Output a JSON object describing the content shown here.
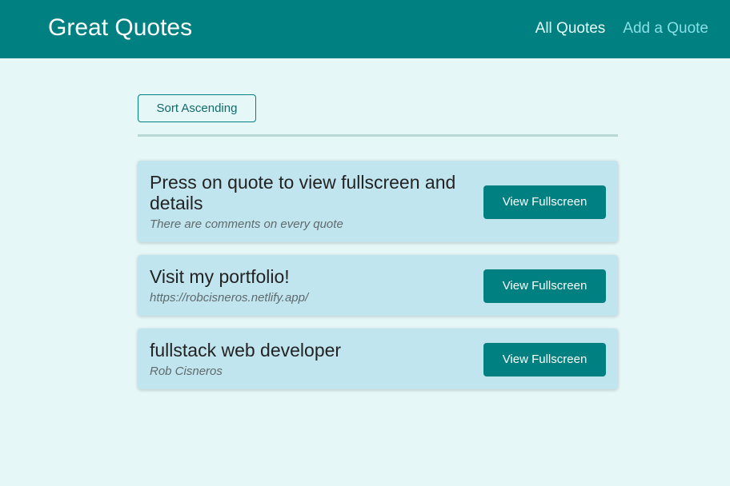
{
  "header": {
    "logo": "Great Quotes",
    "nav": [
      {
        "label": "All Quotes",
        "active": true
      },
      {
        "label": "Add a Quote",
        "active": false
      }
    ]
  },
  "main": {
    "sort_label": "Sort Ascending",
    "quotes": [
      {
        "text": "Press on quote to view fullscreen and details",
        "author": "There are comments on every quote",
        "button_label": "View Fullscreen"
      },
      {
        "text": "Visit my portfolio!",
        "author": "https://robcisneros.netlify.app/",
        "button_label": "View Fullscreen"
      },
      {
        "text": "fullstack web developer",
        "author": "Rob Cisneros",
        "button_label": "View Fullscreen"
      }
    ]
  },
  "colors": {
    "header_bg": "#008080",
    "page_bg": "#e6f7f7",
    "card_bg": "#c1e5ef",
    "button_bg": "#008080"
  }
}
